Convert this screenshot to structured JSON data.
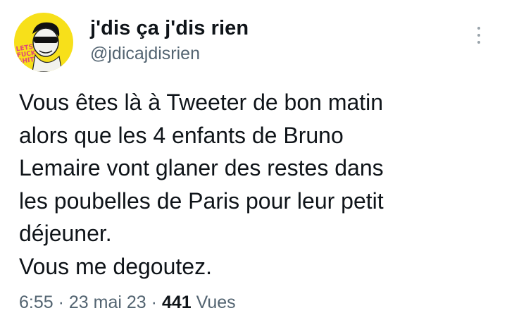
{
  "author": {
    "display_name": "j'dis ça j'dis rien",
    "handle": "@jdicajdisrien",
    "avatar_text": "LETS FUCK SHIT"
  },
  "tweet": {
    "text": "Vous êtes là à Tweeter de bon matin\nalors que les 4 enfants de Bruno\nLemaire vont glaner des restes dans\nles poubelles de Paris pour leur petit\ndéjeuner.\nVous me degoutez."
  },
  "meta": {
    "time": "6:55",
    "separator": "·",
    "date": "23 mai 23",
    "views_count": "441",
    "views_label": "Vues"
  },
  "icons": {
    "more": "more-vertical-icon"
  },
  "colors": {
    "avatar_bg": "#f7e01a",
    "text_primary": "#0f1419",
    "text_secondary": "#536471"
  }
}
